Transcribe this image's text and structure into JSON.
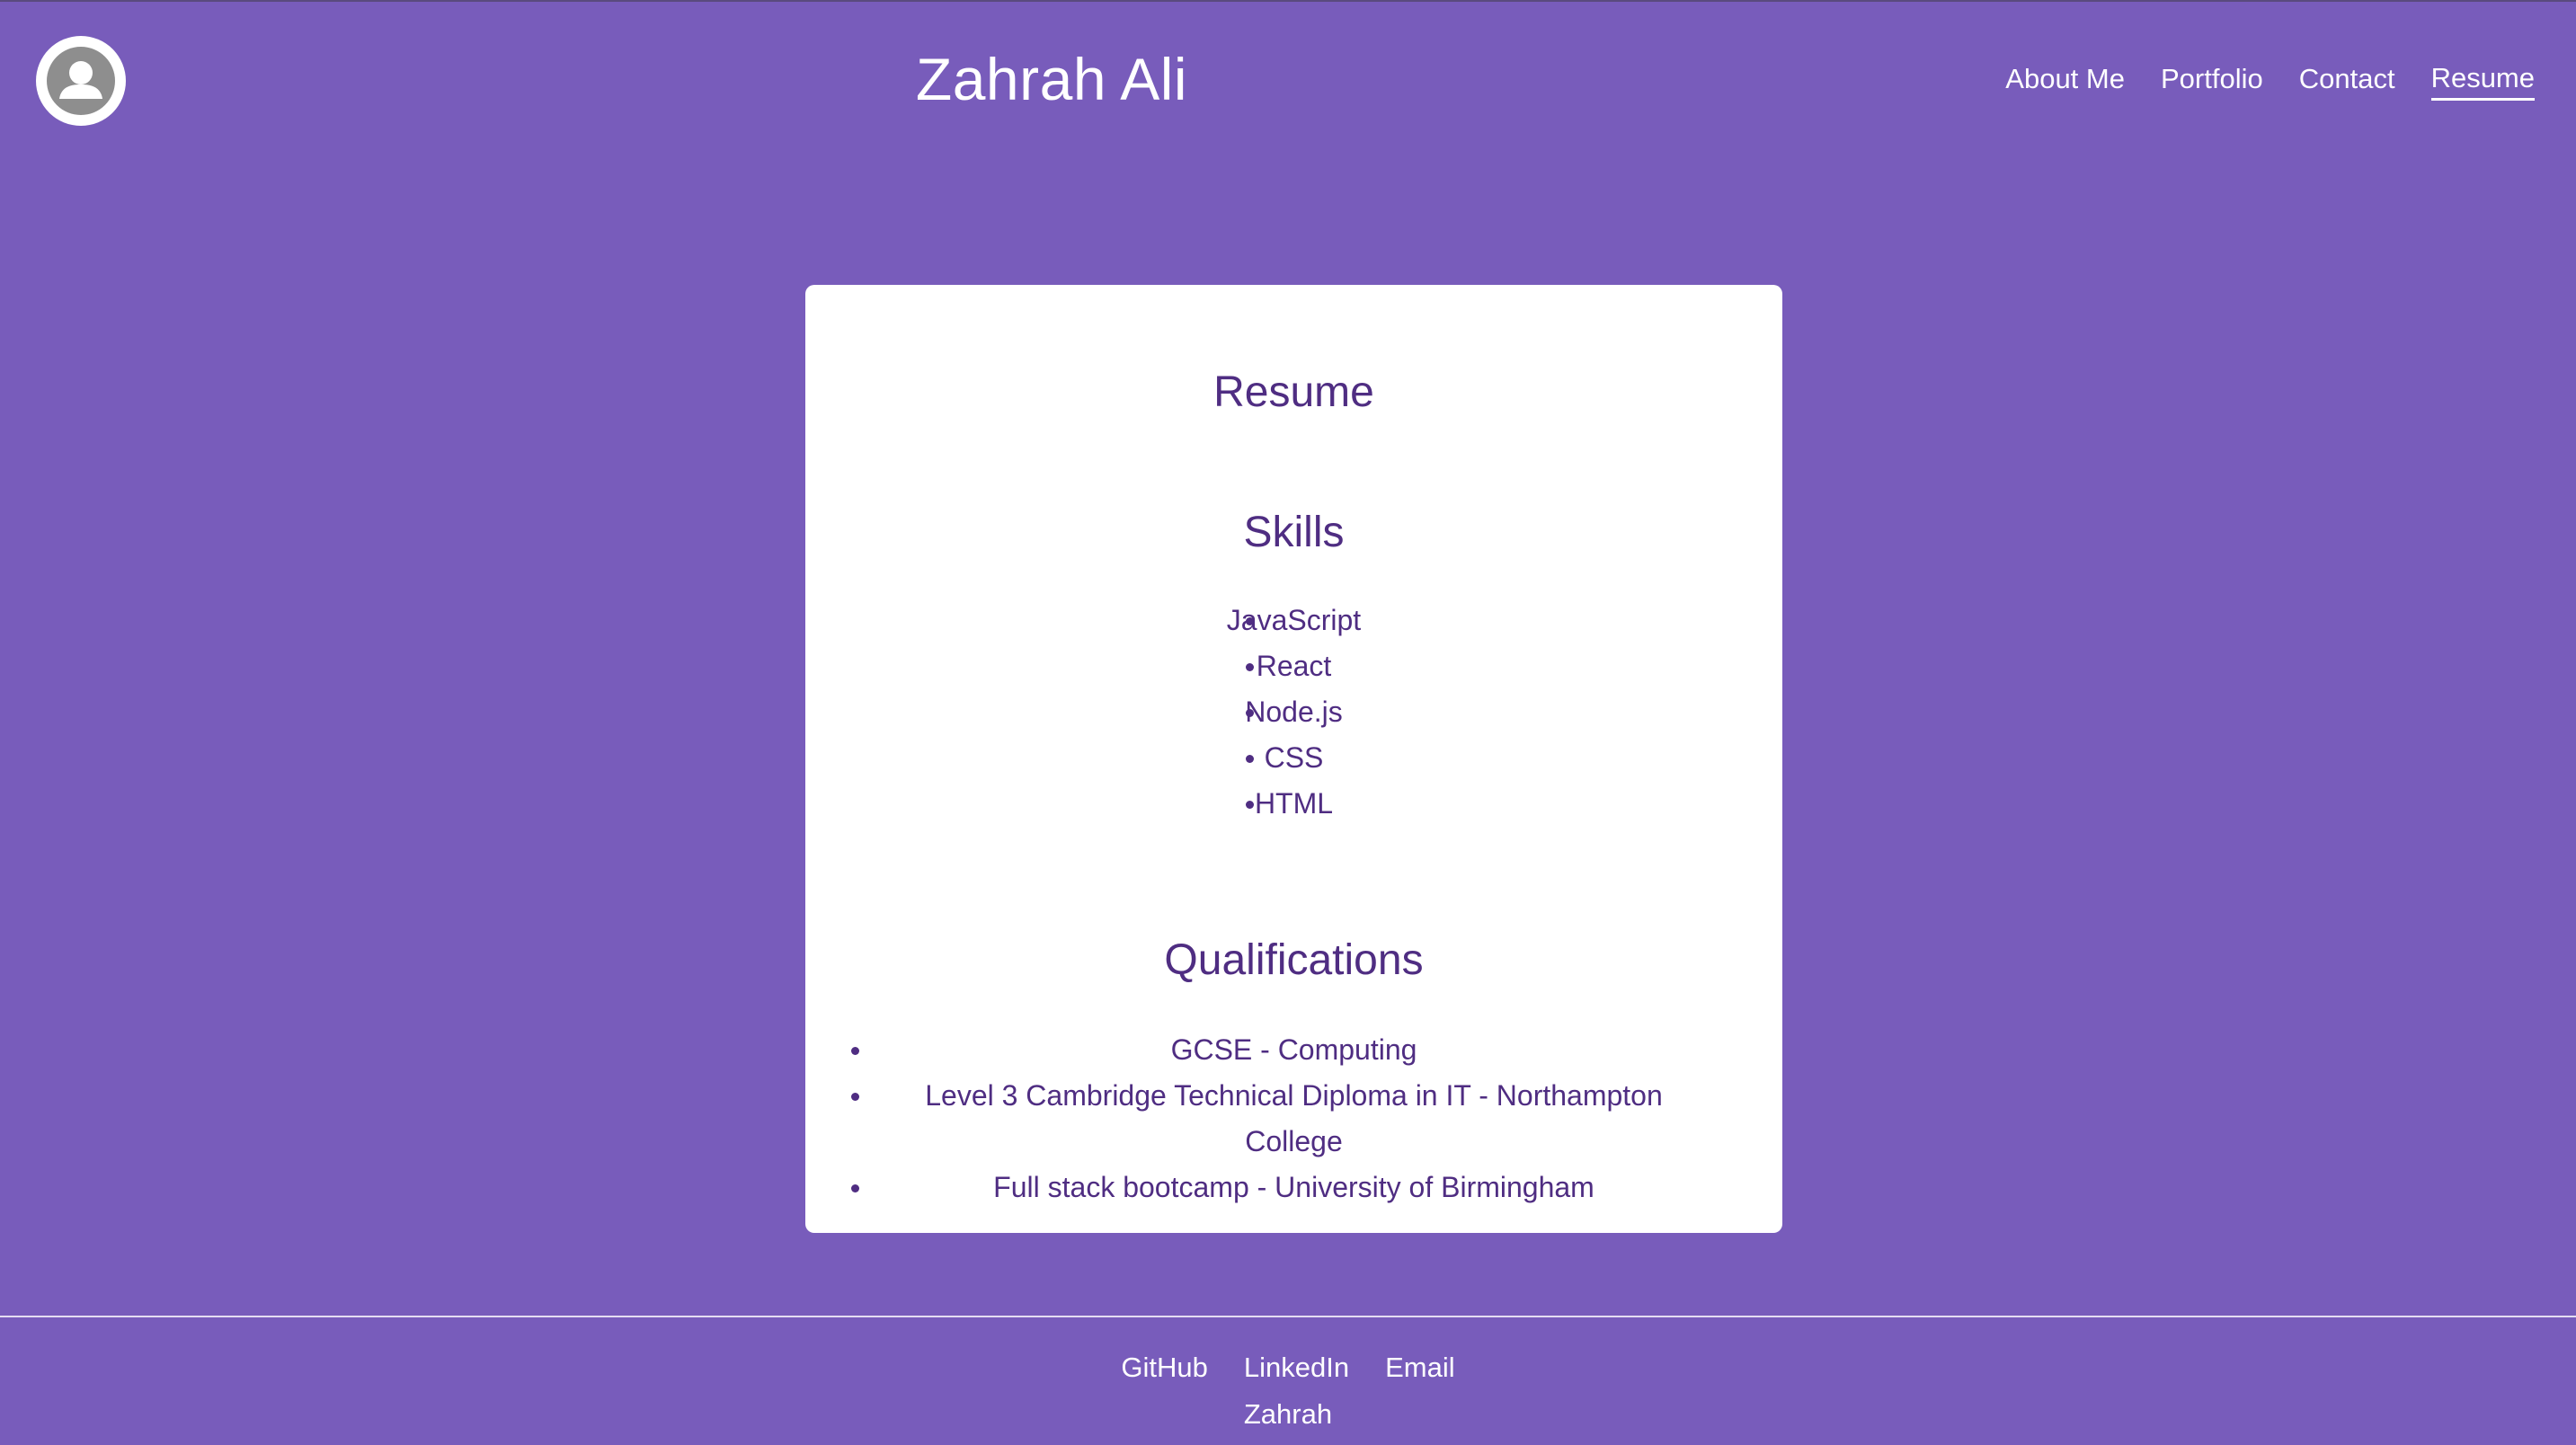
{
  "header": {
    "avatar_icon": "user-avatar-icon",
    "title": "Zahrah Ali",
    "nav": [
      {
        "label": "About Me",
        "active": false
      },
      {
        "label": "Portfolio",
        "active": false
      },
      {
        "label": "Contact",
        "active": false
      },
      {
        "label": "Resume",
        "active": true
      }
    ]
  },
  "card": {
    "title": "Resume",
    "skills_title": "Skills",
    "skills": [
      "JavaScript",
      "React",
      "Node.js",
      "CSS",
      "HTML"
    ],
    "qualifications_title": "Qualifications",
    "qualifications": [
      "GCSE - Computing",
      "Level 3 Cambridge Technical Diploma in IT - Northampton College",
      "Full stack bootcamp - University of Birmingham"
    ]
  },
  "footer": {
    "links": [
      "GitHub",
      "LinkedIn",
      "Email"
    ],
    "name": "Zahrah"
  },
  "colors": {
    "background": "#785cbb",
    "card_text": "#4f2d82",
    "card_background": "#ffffff"
  }
}
